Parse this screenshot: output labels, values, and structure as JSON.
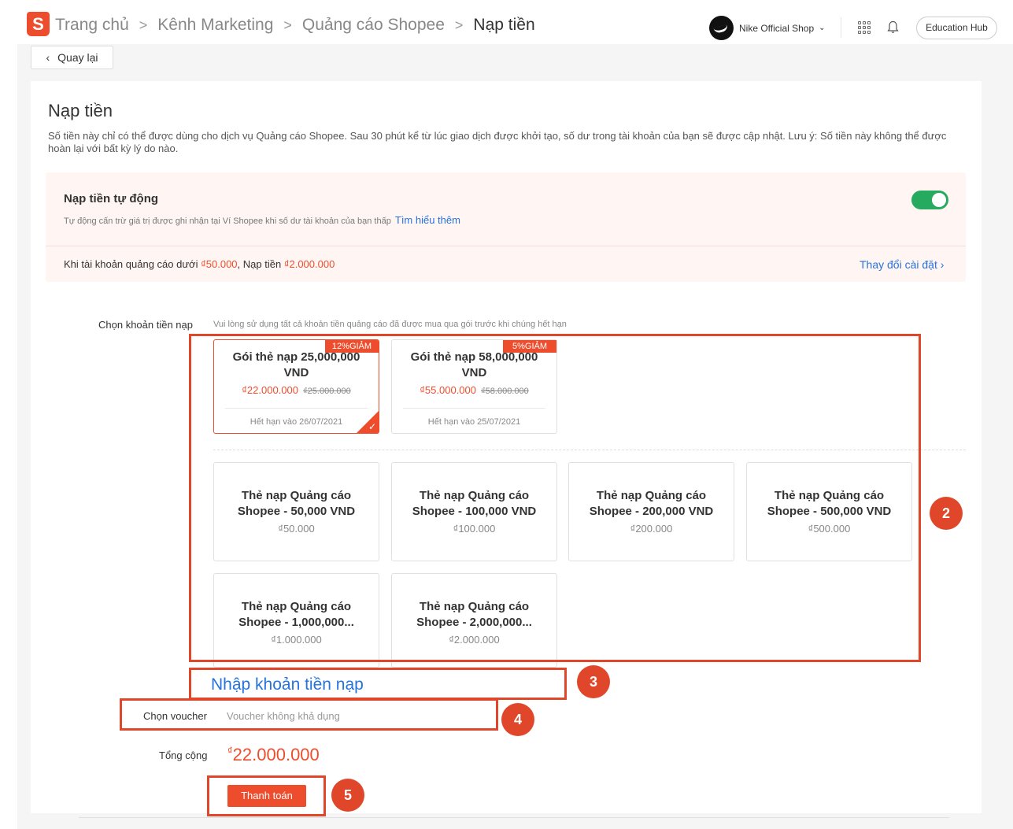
{
  "breadcrumb": {
    "items": [
      "Trang chủ",
      "Kênh Marketing",
      "Quảng cáo Shopee",
      "Nạp tiền"
    ],
    "separator": ">"
  },
  "header": {
    "logo_letter": "S",
    "shop_name": "Nike Official Shop",
    "hub_label": "Education Hub"
  },
  "back_label": "Quay lại",
  "page": {
    "title": "Nạp tiền",
    "description": "Số tiền này chỉ có thể được dùng cho dịch vụ Quảng cáo Shopee. Sau 30 phút kể từ lúc giao dịch được khởi tạo, số dư trong tài khoản của bạn sẽ được cập nhật. Lưu ý: Số tiền này không thể được hoàn lại với bất kỳ lý do nào."
  },
  "auto_topup": {
    "title": "Nạp tiền tự động",
    "subtitle": "Tự động cấn trừ giá trị được ghi nhận tại Ví Shopee khi số dư tài khoản của bạn thấp",
    "learn_more": "Tìm hiểu thêm",
    "enabled": true,
    "rule_prefix": "Khi tài khoản quảng cáo dưới",
    "threshold": "₫50.000",
    "rule_middle": ", Nạp tiền",
    "amount": "₫2.000.000",
    "change_label": "Thay đổi cài đặt"
  },
  "choose": {
    "label": "Chọn khoản tiền nạp",
    "hint": "Vui lòng sử dụng tất cả khoản tiền quảng cáo đã được mua qua gói trước khi chúng hết hạn"
  },
  "packages": [
    {
      "name": "Gói thẻ nạp 25,000,000 VND",
      "badge": "12%GIẢM",
      "price": "₫22.000.000",
      "old_price": "₫25.000.000",
      "expiry": "Hết hạn vào 26/07/2021",
      "selected": true
    },
    {
      "name": "Gói thẻ nạp 58,000,000 VND",
      "badge": "5%GIẢM",
      "price": "₫55.000.000",
      "old_price": "₫58.000.000",
      "expiry": "Hết hạn vào 25/07/2021",
      "selected": false
    }
  ],
  "cards": [
    {
      "name": "Thẻ nạp Quảng cáo Shopee - 50,000 VND",
      "price": "₫50.000"
    },
    {
      "name": "Thẻ nạp Quảng cáo Shopee - 100,000 VND",
      "price": "₫100.000"
    },
    {
      "name": "Thẻ nạp Quảng cáo Shopee - 200,000 VND",
      "price": "₫200.000"
    },
    {
      "name": "Thẻ nạp Quảng cáo Shopee - 500,000 VND",
      "price": "₫500.000"
    },
    {
      "name": "Thẻ nạp Quảng cáo Shopee - 1,000,000...",
      "price": "₫1.000.000"
    },
    {
      "name": "Thẻ nạp Quảng cáo Shopee - 2,000,000...",
      "price": "₫2.000.000"
    }
  ],
  "custom_amount_label": "Nhập khoản tiền nạp",
  "voucher": {
    "label": "Chọn voucher",
    "value": "Voucher không khả dụng"
  },
  "total": {
    "label": "Tổng cộng",
    "currency": "₫",
    "value": "22.000.000"
  },
  "pay_label": "Thanh toán",
  "callouts": [
    "2",
    "3",
    "4",
    "5"
  ],
  "colors": {
    "accent": "#ee4d2d",
    "link": "#2673dd",
    "toggle_on": "#26aa5f",
    "callout": "#e0472a"
  },
  "icons": [
    "shopee-logo-icon",
    "chevron-right-icon",
    "chevron-down-icon",
    "apps-grid-icon",
    "bell-icon",
    "chevron-left-icon",
    "check-icon"
  ]
}
